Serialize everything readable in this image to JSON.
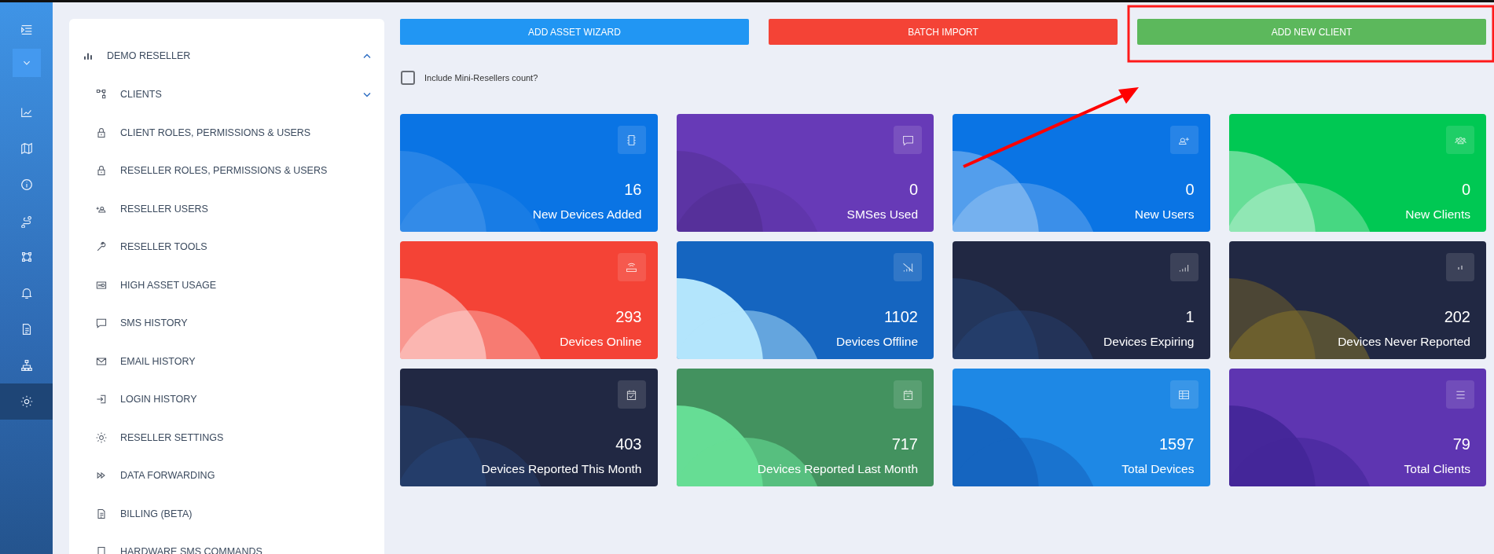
{
  "rail": {
    "items": [
      {
        "kind": "toggle",
        "selected": false
      },
      {
        "kind": "dropdown",
        "selected": false
      },
      {
        "kind": "nav",
        "selected": false
      },
      {
        "kind": "nav",
        "selected": false
      },
      {
        "kind": "nav",
        "selected": false
      },
      {
        "kind": "nav",
        "selected": false
      },
      {
        "kind": "nav",
        "selected": false
      },
      {
        "kind": "nav",
        "selected": false
      },
      {
        "kind": "nav",
        "selected": false
      },
      {
        "kind": "nav",
        "selected": false
      },
      {
        "kind": "nav",
        "selected": true
      }
    ]
  },
  "menu": {
    "title": "DEMO RESELLER",
    "expanded": true,
    "items": [
      {
        "label": "CLIENTS",
        "expanded": false
      },
      {
        "label": "CLIENT ROLES, PERMISSIONS & USERS"
      },
      {
        "label": "RESELLER ROLES, PERMISSIONS & USERS"
      },
      {
        "label": "RESELLER USERS"
      },
      {
        "label": "RESELLER TOOLS"
      },
      {
        "label": "HIGH ASSET USAGE"
      },
      {
        "label": "SMS HISTORY"
      },
      {
        "label": "EMAIL HISTORY"
      },
      {
        "label": "LOGIN HISTORY"
      },
      {
        "label": "RESELLER SETTINGS"
      },
      {
        "label": "DATA FORWARDING"
      },
      {
        "label": "BILLING (BETA)"
      },
      {
        "label": "HARDWARE SMS COMMANDS"
      }
    ]
  },
  "actions": [
    {
      "label": "ADD ASSET WIZARD",
      "color": "#2196f3",
      "highlighted": false
    },
    {
      "label": "BATCH IMPORT",
      "color": "#f44336",
      "highlighted": false
    },
    {
      "label": "ADD NEW CLIENT",
      "color": "#5cb85c",
      "highlighted": true
    }
  ],
  "mini_resellers": {
    "label": "Include Mini-Resellers count?",
    "checked": false
  },
  "stats": [
    {
      "value": "16",
      "label": "New Devices Added",
      "color": "#0a74e4"
    },
    {
      "value": "0",
      "label": "SMSes Used",
      "color": "#673ab7"
    },
    {
      "value": "0",
      "label": "New Users",
      "color": "#0a74e4"
    },
    {
      "value": "0",
      "label": "New Clients",
      "color": "#00c853"
    },
    {
      "value": "293",
      "label": "Devices Online",
      "color": "#f44336"
    },
    {
      "value": "1102",
      "label": "Devices Offline",
      "color": "#1565c0"
    },
    {
      "value": "1",
      "label": "Devices Expiring",
      "color": "#212843"
    },
    {
      "value": "202",
      "label": "Devices Never Reported",
      "color": "#212843"
    },
    {
      "value": "403",
      "label": "Devices Reported This Month",
      "color": "#212843"
    },
    {
      "value": "717",
      "label": "Devices Reported Last Month",
      "color": "#43925f"
    },
    {
      "value": "1597",
      "label": "Total Devices",
      "color": "#1e88e5"
    },
    {
      "value": "79",
      "label": "Total Clients",
      "color": "#5e35b1"
    }
  ]
}
